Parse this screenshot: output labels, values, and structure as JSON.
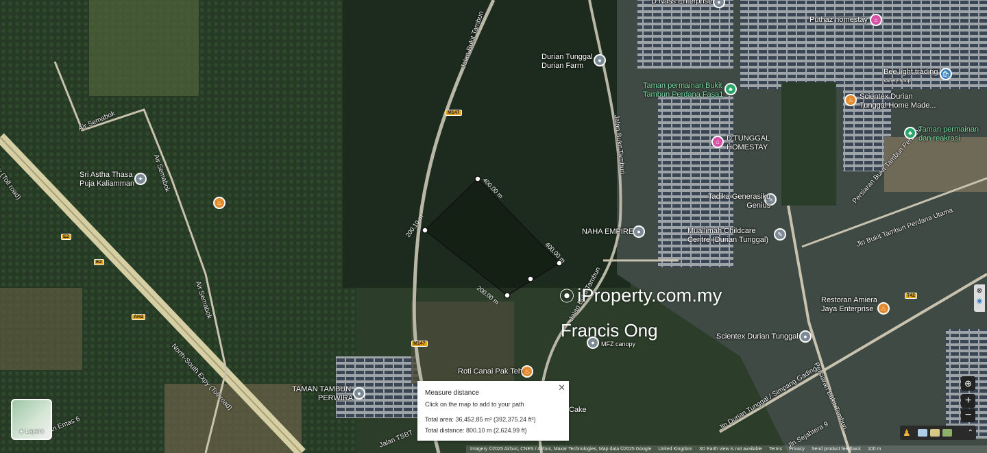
{
  "places": [
    {
      "name": "Durian Tunggal Durian Farm",
      "lines": [
        "Durian Tunggal",
        "Durian Farm"
      ]
    },
    {
      "name": "Taman permainan Bukit Tambun Perdana Fasa1",
      "lines": [
        "Taman permainan Bukit",
        "Tambun Perdana Fasa1"
      ]
    },
    {
      "name": "Sri Astha Thasa Puja Kaliamman",
      "lines": [
        "Sri Astha Thasa",
        "Puja Kaliamman"
      ]
    },
    {
      "name": "D'TUNGGAL HOMESTAY",
      "lines": [
        "D'TUNGGAL",
        "HOMESTAY"
      ]
    },
    {
      "name": "Tadika Generasiku Genius",
      "lines": [
        "Tadika Generasiku",
        "Genius"
      ]
    },
    {
      "name": "NAHA EMPIRE",
      "lines": [
        "NAHA EMPIRE"
      ]
    },
    {
      "name": "Muallimah Childcare Centre (Durian Tunggal)",
      "lines": [
        "Muallimah Childcare",
        "Centre (Durian Tunggal)"
      ]
    },
    {
      "name": "Restoran Amiera Jaya Enterprise",
      "lines": [
        "Restoran Amiera",
        "Jaya Enterprise"
      ]
    },
    {
      "name": "Scientex Durian Tunggal",
      "lines": [
        "Scientex Durian Tunggal"
      ]
    },
    {
      "name": "Scientex Durian Tunggal Home Made...",
      "lines": [
        "Scientex Durian",
        "Tunggal Home Made..."
      ]
    },
    {
      "name": "Taman permainan dan reakrasi",
      "lines": [
        "Taman permainan",
        "dan reakrasi"
      ]
    },
    {
      "name": "Bee light trading",
      "lines": [
        "Bee light trading"
      ],
      "sub": "Variety Shop"
    },
    {
      "name": "Puthaz homestay",
      "lines": [
        "Puthaz homestay"
      ]
    },
    {
      "name": "MFZ canopy",
      "lines": [
        "MFZ canopy"
      ]
    },
    {
      "name": "Roti Canai Pak Teh",
      "lines": [
        "Roti Canai Pak Teh"
      ]
    },
    {
      "name": "TAMAN TAMBUN PERWIRA",
      "lines": [
        "TAMAN TAMBUN",
        "PERWIRA"
      ]
    },
    {
      "name": "D Nass Enterprise",
      "lines": [
        "D Nass Enterprise"
      ]
    },
    {
      "name": "Cake",
      "lines": [
        "Cake"
      ]
    }
  ],
  "roads": [
    "Jalan Bukit Tambun",
    "Jalan Bukit Tambun",
    "Air Semabok",
    "Air Semabok",
    "Air Semabok",
    "North-South Expy (Toll road)",
    "Expy (Toll road)",
    "Persiaran Bukit Tambun Perdana",
    "Jln Bukit Tambun Perdana Utama",
    "Jln Durian Tunggal / Simpang Gading",
    "Persiaran Bukit Tambun",
    "Jln Sejahtera 9",
    "Jalan TSBT",
    "Jalan Emas 6",
    "Jalan Bukit Tambun"
  ],
  "shields": [
    "M147",
    "M147",
    "E2",
    "E2",
    "AH2",
    "T42"
  ],
  "measurements": [
    "400.00 m",
    "400.00 m",
    "200.00 m",
    "200.10 m"
  ],
  "watermark": {
    "brand": "iProperty.com.my",
    "name": "Francis Ong"
  },
  "measure_panel": {
    "title": "Measure distance",
    "hint": "Click on the map to add to your path",
    "area": "Total area: 36,452.85 m² (392,375.24 ft²)",
    "distance": "Total distance: 800.10 m (2,624.99 ft)"
  },
  "layers_label": "Layers",
  "attribution": {
    "imagery": "Imagery ©2025 Airbus, CNES / Airbus, Maxar Technologies, Map data ©2025 Google",
    "country": "United Kingdom",
    "earth": "3D Earth view is not available",
    "terms": "Terms",
    "privacy": "Privacy",
    "feedback": "Send product feedback",
    "scale": "100 m"
  },
  "colors": {
    "pin_gray": "#7c8a95",
    "pin_pink": "#d94fa6",
    "pin_orange": "#e38a2c",
    "pin_green": "#27a56a",
    "pin_blue": "#3b82c4"
  }
}
